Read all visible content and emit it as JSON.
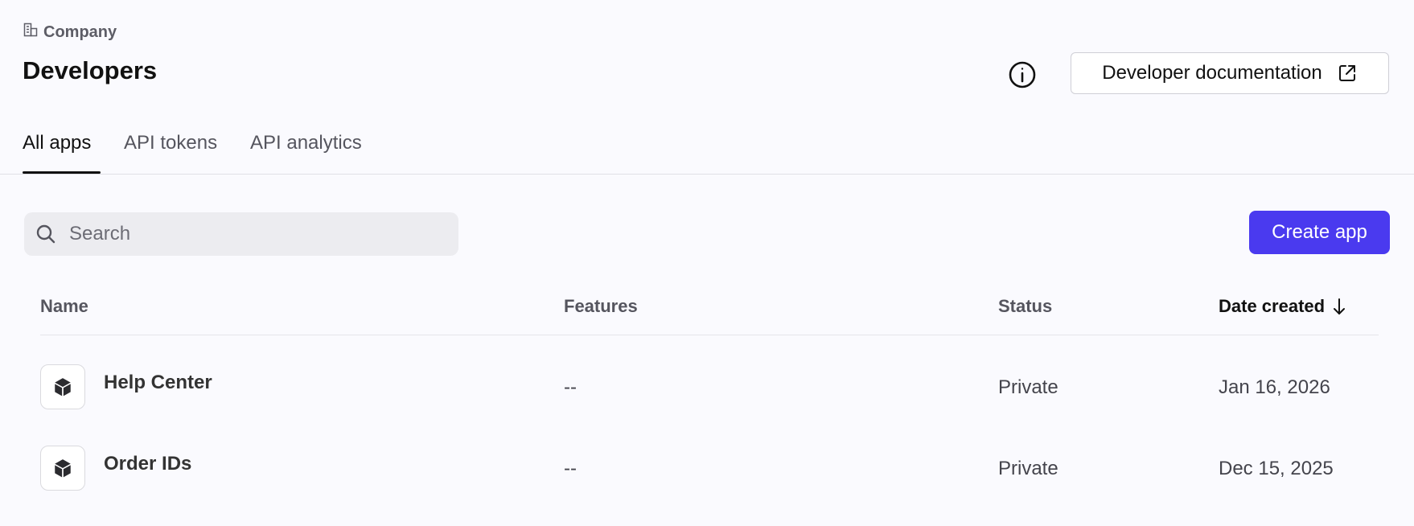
{
  "breadcrumb": {
    "label": "Company",
    "icon": "building-icon"
  },
  "page": {
    "title": "Developers"
  },
  "header": {
    "info_icon": "info-icon",
    "doc_button_label": "Developer documentation",
    "doc_button_icon": "external-link-icon"
  },
  "tabs": [
    {
      "label": "All apps",
      "active": true
    },
    {
      "label": "API tokens",
      "active": false
    },
    {
      "label": "API analytics",
      "active": false
    }
  ],
  "search": {
    "placeholder": "Search",
    "value": ""
  },
  "toolbar": {
    "create_label": "Create app"
  },
  "table": {
    "columns": [
      "Name",
      "Features",
      "Status",
      "Date created"
    ],
    "sorted_column": "Date created",
    "sort_direction": "descending",
    "rows": [
      {
        "name": "Help Center",
        "features": "--",
        "status": "Private",
        "date": "Jan 16, 2026",
        "icon": "cube-icon"
      },
      {
        "name": "Order IDs",
        "features": "--",
        "status": "Private",
        "date": "Dec 15, 2025",
        "icon": "cube-icon"
      }
    ]
  },
  "colors": {
    "accent": "#4a3aef",
    "background": "#fafafe",
    "search_bg": "#ececf0"
  }
}
